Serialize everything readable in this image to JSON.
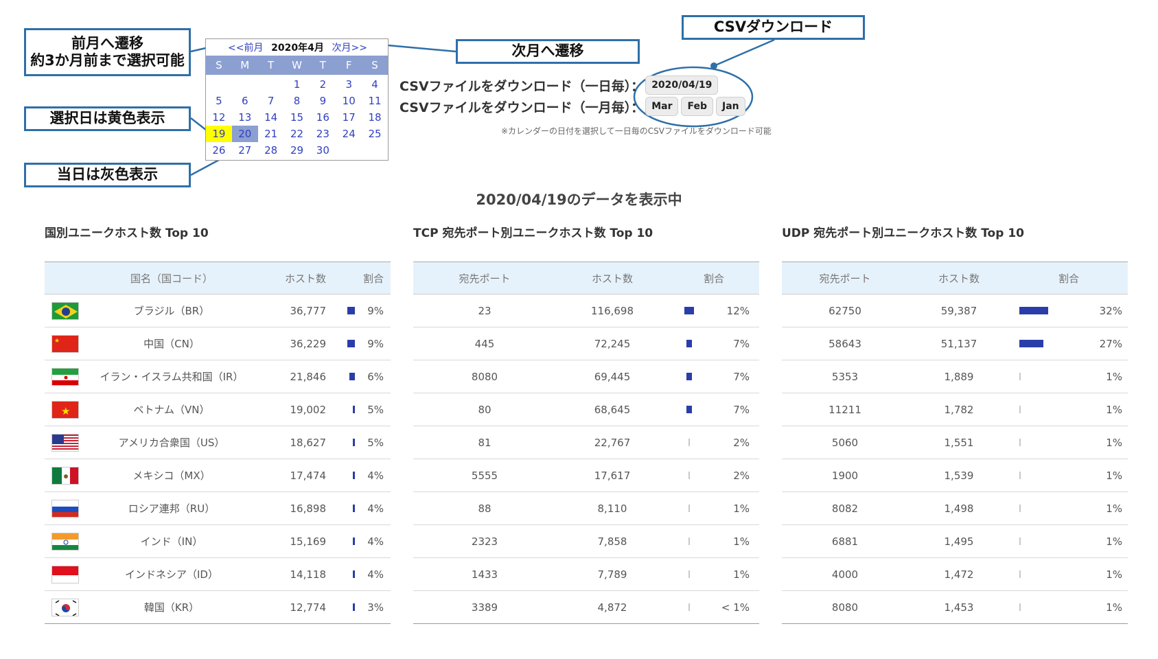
{
  "callouts": {
    "prev_line1": "前月へ遷移",
    "prev_line2": "約3か月前まで選択可能",
    "next": "次月へ遷移",
    "csv": "CSVダウンロード",
    "selected": "選択日は黄色表示",
    "today": "当日は灰色表示"
  },
  "calendar": {
    "prev": "<<前月",
    "title": "2020年4月",
    "next": "次月>>",
    "dow": [
      "S",
      "M",
      "T",
      "W",
      "T",
      "F",
      "S"
    ],
    "days": [
      "",
      "",
      "",
      "1",
      "2",
      "3",
      "4",
      "5",
      "6",
      "7",
      "8",
      "9",
      "10",
      "11",
      "12",
      "13",
      "14",
      "15",
      "16",
      "17",
      "18",
      "19",
      "20",
      "21",
      "22",
      "23",
      "24",
      "25",
      "26",
      "27",
      "28",
      "29",
      "30",
      "",
      ""
    ],
    "selected_day": "19",
    "today_day": "20"
  },
  "csv": {
    "daily_label": "CSVファイルをダウンロード（一日毎）：",
    "daily_button": "2020/04/19",
    "monthly_label": "CSVファイルをダウンロード（一月毎）：",
    "monthly_buttons": [
      "Mar",
      "Feb",
      "Jan"
    ],
    "note": "※カレンダーの日付を選択して一日毎のCSVファイルをダウンロード可能"
  },
  "showing": "2020/04/19のデータを表示中",
  "country_table": {
    "title": "国別ユニークホスト数 Top 10",
    "headers": [
      "国名（国コード）",
      "ホスト数",
      "割合"
    ],
    "rows": [
      {
        "flag": "brazil-flag-icon",
        "name": "ブラジル（BR）",
        "hosts": "36,777",
        "pct": "9%",
        "ratio": 9
      },
      {
        "flag": "china-flag-icon",
        "name": "中国（CN）",
        "hosts": "36,229",
        "pct": "9%",
        "ratio": 9
      },
      {
        "flag": "iran-flag-icon",
        "name": "イラン・イスラム共和国（IR）",
        "hosts": "21,846",
        "pct": "6%",
        "ratio": 6
      },
      {
        "flag": "vietnam-flag-icon",
        "name": "ベトナム（VN）",
        "hosts": "19,002",
        "pct": "5%",
        "ratio": 5
      },
      {
        "flag": "usa-flag-icon",
        "name": "アメリカ合衆国（US）",
        "hosts": "18,627",
        "pct": "5%",
        "ratio": 5
      },
      {
        "flag": "mexico-flag-icon",
        "name": "メキシコ（MX）",
        "hosts": "17,474",
        "pct": "4%",
        "ratio": 4
      },
      {
        "flag": "russia-flag-icon",
        "name": "ロシア連邦（RU）",
        "hosts": "16,898",
        "pct": "4%",
        "ratio": 4
      },
      {
        "flag": "india-flag-icon",
        "name": "インド（IN）",
        "hosts": "15,169",
        "pct": "4%",
        "ratio": 4
      },
      {
        "flag": "indonesia-flag-icon",
        "name": "インドネシア（ID）",
        "hosts": "14,118",
        "pct": "4%",
        "ratio": 4
      },
      {
        "flag": "korea-flag-icon",
        "name": "韓国（KR）",
        "hosts": "12,774",
        "pct": "3%",
        "ratio": 3
      }
    ]
  },
  "tcp_table": {
    "title": "TCP 宛先ポート別ユニークホスト数 Top 10",
    "headers": [
      "宛先ポート",
      "ホスト数",
      "割合"
    ],
    "rows": [
      {
        "port": "23",
        "hosts": "116,698",
        "pct": "12%",
        "ratio": 12
      },
      {
        "port": "445",
        "hosts": "72,245",
        "pct": "7%",
        "ratio": 7
      },
      {
        "port": "8080",
        "hosts": "69,445",
        "pct": "7%",
        "ratio": 7
      },
      {
        "port": "80",
        "hosts": "68,645",
        "pct": "7%",
        "ratio": 7
      },
      {
        "port": "81",
        "hosts": "22,767",
        "pct": "2%",
        "ratio": 2
      },
      {
        "port": "5555",
        "hosts": "17,617",
        "pct": "2%",
        "ratio": 2
      },
      {
        "port": "88",
        "hosts": "8,110",
        "pct": "1%",
        "ratio": 1
      },
      {
        "port": "2323",
        "hosts": "7,858",
        "pct": "1%",
        "ratio": 1
      },
      {
        "port": "1433",
        "hosts": "7,789",
        "pct": "1%",
        "ratio": 1
      },
      {
        "port": "3389",
        "hosts": "4,872",
        "pct": "< 1%",
        "ratio": 0.5
      }
    ]
  },
  "udp_table": {
    "title": "UDP 宛先ポート別ユニークホスト数 Top 10",
    "headers": [
      "宛先ポート",
      "ホスト数",
      "割合"
    ],
    "rows": [
      {
        "port": "62750",
        "hosts": "59,387",
        "pct": "32%",
        "ratio": 32
      },
      {
        "port": "58643",
        "hosts": "51,137",
        "pct": "27%",
        "ratio": 27
      },
      {
        "port": "5353",
        "hosts": "1,889",
        "pct": "1%",
        "ratio": 1
      },
      {
        "port": "11211",
        "hosts": "1,782",
        "pct": "1%",
        "ratio": 1
      },
      {
        "port": "5060",
        "hosts": "1,551",
        "pct": "1%",
        "ratio": 1
      },
      {
        "port": "1900",
        "hosts": "1,539",
        "pct": "1%",
        "ratio": 1
      },
      {
        "port": "8082",
        "hosts": "1,498",
        "pct": "1%",
        "ratio": 1
      },
      {
        "port": "6881",
        "hosts": "1,495",
        "pct": "1%",
        "ratio": 1
      },
      {
        "port": "4000",
        "hosts": "1,472",
        "pct": "1%",
        "ratio": 1
      },
      {
        "port": "8080",
        "hosts": "1,453",
        "pct": "1%",
        "ratio": 1
      }
    ]
  },
  "colors": {
    "accent": "#2a3da8",
    "callout_border": "#2e6fa8",
    "selected": "#ffff00",
    "today": "#8c9fd1",
    "header_bg": "#e6f2fb"
  }
}
